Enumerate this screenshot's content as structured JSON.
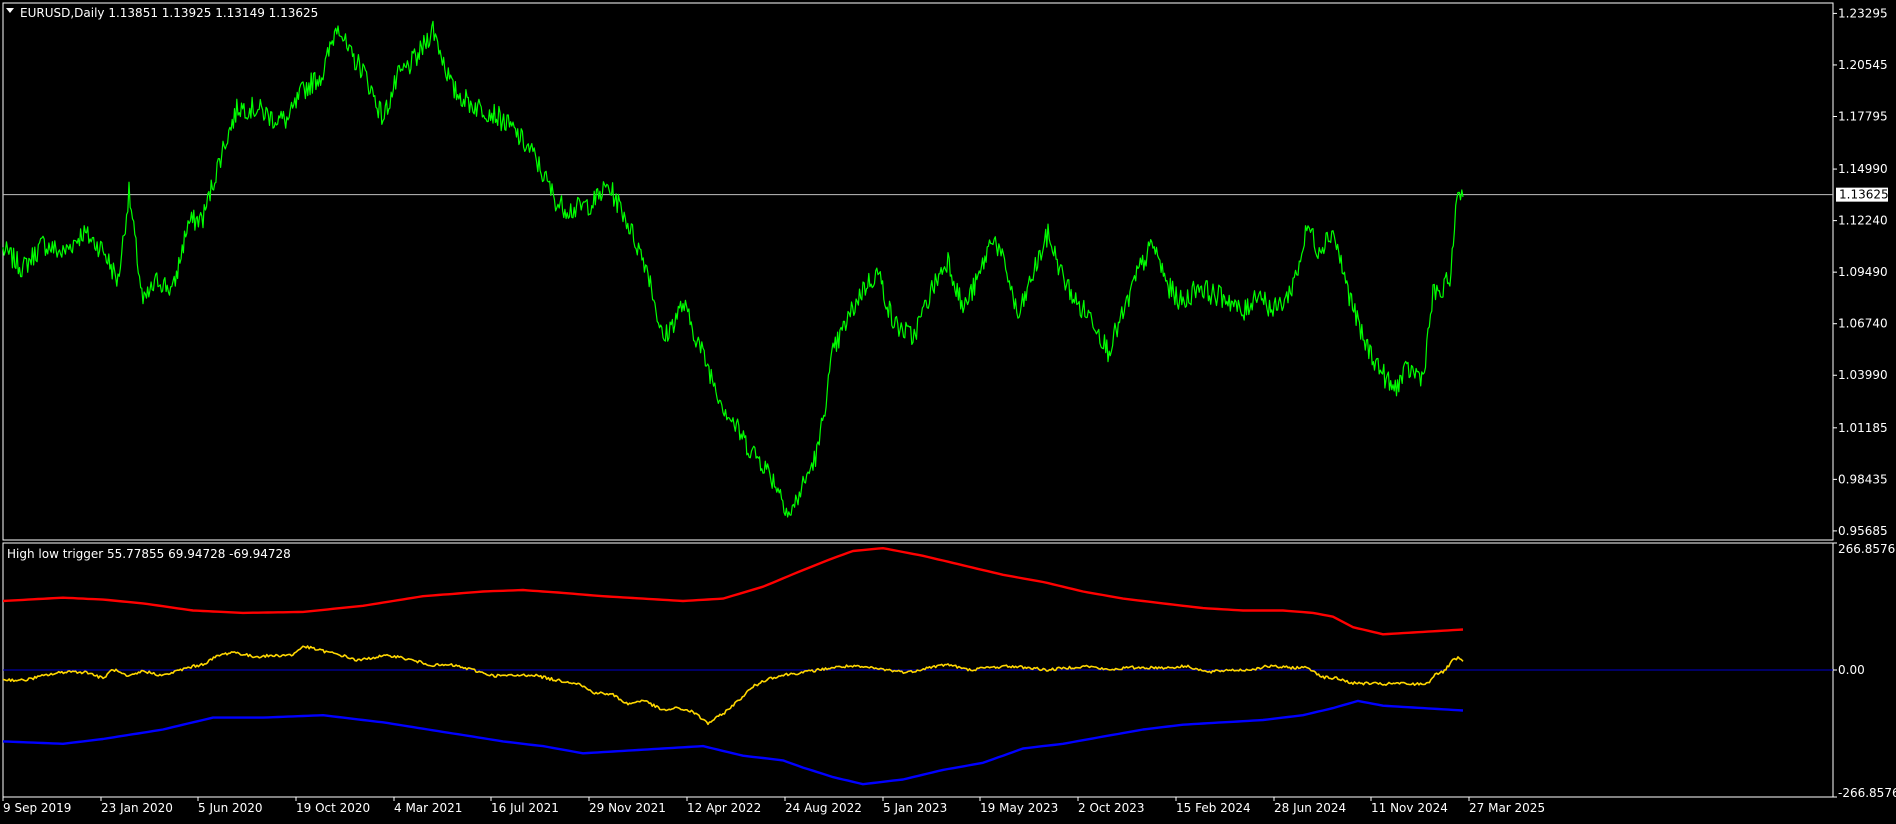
{
  "window": {
    "symbol_header": "EURUSD,Daily  1.13851 1.13925 1.13149 1.13625",
    "indicator_header": "High low trigger 55.77855 69.94728 -69.94728"
  },
  "colors": {
    "background": "#000000",
    "frame": "#ffffff",
    "price_line": "#00ff00",
    "trigger_line": "#ffd700",
    "upper_band": "#ff0000",
    "lower_band": "#0000ff",
    "zero_line": "#0000cd",
    "current_price_line": "#c0c0c0"
  },
  "chart_data": [
    {
      "type": "line",
      "name": "EURUSD Daily",
      "current_price": 1.13625,
      "current_price_label": "1.13625",
      "ylim": [
        0.952,
        1.2385
      ],
      "y_ticks": [
        {
          "v": 1.23295,
          "label": "1.23295"
        },
        {
          "v": 1.20545,
          "label": "1.20545"
        },
        {
          "v": 1.17795,
          "label": "1.17795"
        },
        {
          "v": 1.1499,
          "label": "1.14990"
        },
        {
          "v": 1.1224,
          "label": "1.12240"
        },
        {
          "v": 1.0949,
          "label": "1.09490"
        },
        {
          "v": 1.0674,
          "label": "1.06740"
        },
        {
          "v": 1.0399,
          "label": "1.03990"
        },
        {
          "v": 1.01185,
          "label": "1.01185"
        },
        {
          "v": 0.98435,
          "label": "0.98435"
        },
        {
          "v": 0.95685,
          "label": "0.95685"
        }
      ],
      "x_range": [
        0,
        1524
      ],
      "x_ticks": [
        {
          "x": 0,
          "label": "9 Sep 2019"
        },
        {
          "x": 98,
          "label": "23 Jan 2020"
        },
        {
          "x": 195,
          "label": "5 Jun 2020"
        },
        {
          "x": 293,
          "label": "19 Oct 2020"
        },
        {
          "x": 391,
          "label": "4 Mar 2021"
        },
        {
          "x": 488,
          "label": "16 Jul 2021"
        },
        {
          "x": 586,
          "label": "29 Nov 2021"
        },
        {
          "x": 684,
          "label": "12 Apr 2022"
        },
        {
          "x": 782,
          "label": "24 Aug 2022"
        },
        {
          "x": 880,
          "label": "5 Jan 2023"
        },
        {
          "x": 977,
          "label": "19 May 2023"
        },
        {
          "x": 1075,
          "label": "2 Oct 2023"
        },
        {
          "x": 1173,
          "label": "15 Feb 2024"
        },
        {
          "x": 1271,
          "label": "28 Jun 2024"
        },
        {
          "x": 1368,
          "label": "11 Nov 2024"
        },
        {
          "x": 1466,
          "label": "27 Mar 2025"
        }
      ],
      "series": [
        {
          "key": "price",
          "x": [
            0,
            20,
            40,
            60,
            80,
            100,
            115,
            126,
            140,
            155,
            170,
            185,
            200,
            220,
            235,
            255,
            270,
            285,
            300,
            320,
            335,
            345,
            360,
            380,
            395,
            415,
            430,
            450,
            470,
            490,
            510,
            530,
            555,
            570,
            590,
            605,
            620,
            645,
            660,
            680,
            700,
            720,
            730,
            745,
            760,
            775,
            787,
            795,
            805,
            815,
            830,
            845,
            860,
            875,
            890,
            910,
            930,
            945,
            960,
            975,
            990,
            1005,
            1015,
            1030,
            1045,
            1060,
            1075,
            1090,
            1105,
            1120,
            1135,
            1150,
            1165,
            1180,
            1195,
            1210,
            1225,
            1240,
            1255,
            1270,
            1285,
            1295,
            1305,
            1315,
            1330,
            1345,
            1360,
            1375,
            1390,
            1405,
            1420,
            1430,
            1440,
            1448,
            1455,
            1460
          ],
          "y": [
            1.107,
            1.097,
            1.11,
            1.105,
            1.116,
            1.107,
            1.09,
            1.137,
            1.078,
            1.091,
            1.085,
            1.121,
            1.124,
            1.161,
            1.183,
            1.182,
            1.177,
            1.176,
            1.192,
            1.201,
            1.229,
            1.212,
            1.203,
            1.177,
            1.199,
            1.21,
            1.225,
            1.192,
            1.184,
            1.18,
            1.171,
            1.158,
            1.131,
            1.128,
            1.132,
            1.141,
            1.127,
            1.096,
            1.058,
            1.078,
            1.051,
            1.024,
            1.015,
            1.002,
            0.993,
            0.98,
            0.965,
            0.975,
            0.987,
            1.0,
            1.052,
            1.07,
            1.086,
            1.095,
            1.068,
            1.06,
            1.087,
            1.102,
            1.075,
            1.091,
            1.115,
            1.093,
            1.07,
            1.094,
            1.115,
            1.092,
            1.077,
            1.07,
            1.053,
            1.072,
            1.095,
            1.11,
            1.087,
            1.078,
            1.088,
            1.083,
            1.081,
            1.072,
            1.085,
            1.074,
            1.082,
            1.097,
            1.12,
            1.107,
            1.117,
            1.085,
            1.059,
            1.045,
            1.032,
            1.043,
            1.039,
            1.083,
            1.084,
            1.095,
            1.14,
            1.135
          ]
        }
      ]
    },
    {
      "type": "line",
      "name": "High low trigger",
      "ylim": [
        -266.85769,
        266.85769
      ],
      "y_ticks": [
        {
          "v": 266.85769,
          "label": "266.85769"
        },
        {
          "v": 0,
          "label": "0.00"
        },
        {
          "v": -266.85769,
          "label": "-266.85769"
        }
      ],
      "series": [
        {
          "key": "trigger",
          "x": [
            0,
            20,
            45,
            65,
            85,
            100,
            110,
            125,
            140,
            160,
            170,
            185,
            200,
            215,
            230,
            250,
            270,
            290,
            300,
            320,
            340,
            355,
            375,
            390,
            410,
            430,
            450,
            470,
            490,
            510,
            530,
            550,
            575,
            590,
            610,
            625,
            640,
            660,
            675,
            690,
            705,
            720,
            735,
            750,
            765,
            782,
            800,
            815,
            830,
            845,
            865,
            885,
            905,
            925,
            945,
            965,
            985,
            1005,
            1025,
            1045,
            1065,
            1085,
            1105,
            1125,
            1145,
            1165,
            1185,
            1205,
            1225,
            1245,
            1265,
            1285,
            1305,
            1320,
            1335,
            1350,
            1365,
            1380,
            1395,
            1410,
            1425,
            1432,
            1440,
            1450,
            1455,
            1460
          ],
          "y": [
            -20,
            -22,
            -10,
            -3,
            -5,
            -18,
            2,
            -15,
            -2,
            -12,
            -5,
            5,
            12,
            30,
            38,
            28,
            30,
            32,
            50,
            40,
            30,
            20,
            28,
            30,
            20,
            10,
            10,
            0,
            -12,
            -12,
            -10,
            -20,
            -28,
            -47,
            -52,
            -72,
            -63,
            -85,
            -80,
            -88,
            -112,
            -92,
            -65,
            -35,
            -18,
            -10,
            -5,
            0,
            5,
            8,
            5,
            0,
            -5,
            5,
            12,
            0,
            5,
            8,
            5,
            0,
            5,
            8,
            0,
            5,
            5,
            5,
            8,
            -5,
            0,
            0,
            8,
            5,
            5,
            -15,
            -18,
            -28,
            -28,
            -30,
            -28,
            -30,
            -28,
            -8,
            -5,
            20,
            25,
            18
          ]
        },
        {
          "key": "upper",
          "x": [
            0,
            60,
            100,
            140,
            190,
            240,
            300,
            360,
            420,
            480,
            520,
            560,
            600,
            640,
            680,
            720,
            760,
            800,
            830,
            850,
            880,
            920,
            960,
            1000,
            1040,
            1080,
            1120,
            1160,
            1200,
            1240,
            1280,
            1310,
            1330,
            1350,
            1380,
            1420,
            1460
          ],
          "y": [
            145,
            152,
            148,
            140,
            125,
            120,
            122,
            135,
            155,
            165,
            168,
            162,
            155,
            150,
            145,
            150,
            175,
            210,
            235,
            250,
            256,
            240,
            220,
            200,
            185,
            165,
            150,
            140,
            130,
            125,
            125,
            120,
            112,
            90,
            75,
            80,
            85
          ]
        },
        {
          "key": "lower",
          "x": [
            0,
            60,
            100,
            160,
            210,
            260,
            320,
            380,
            440,
            500,
            540,
            580,
            620,
            660,
            700,
            740,
            780,
            800,
            830,
            860,
            900,
            940,
            980,
            1020,
            1060,
            1100,
            1140,
            1180,
            1220,
            1260,
            1300,
            1330,
            1355,
            1380,
            1420,
            1460
          ],
          "y": [
            -150,
            -155,
            -145,
            -125,
            -100,
            -100,
            -95,
            -110,
            -130,
            -150,
            -160,
            -175,
            -170,
            -165,
            -160,
            -180,
            -190,
            -205,
            -225,
            -240,
            -230,
            -210,
            -195,
            -165,
            -155,
            -140,
            -125,
            -115,
            -110,
            -105,
            -95,
            -80,
            -65,
            -75,
            -80,
            -85
          ]
        }
      ]
    }
  ]
}
